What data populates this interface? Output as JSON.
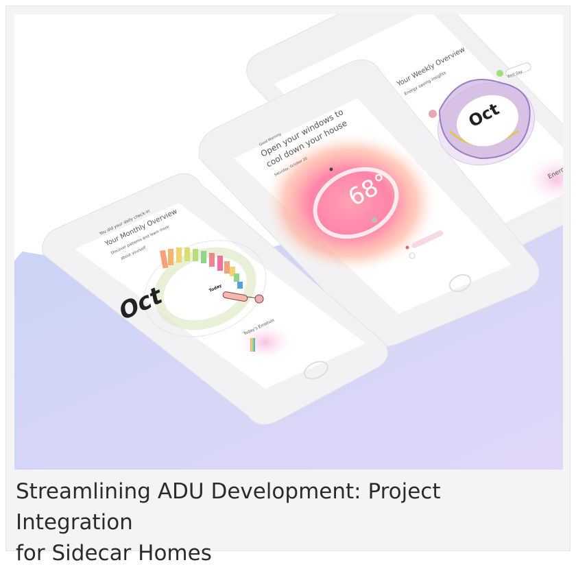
{
  "caption": {
    "line1": "Streamlining ADU Development: Project Integration",
    "line2": "for Sidecar Homes"
  },
  "phone_left": {
    "checkin": "You did your daily check-in",
    "title": "Your Monthly Overview",
    "subtitle1": "Discover patterns and learn more",
    "subtitle2": "about yourself",
    "month": "Oct",
    "today": "Today",
    "emotion_label": "Today's Emotion"
  },
  "phone_center": {
    "greeting": "Good Morning",
    "headline1": "Open your windows to",
    "headline2": "cool down your house",
    "date": "Saturday, October 20",
    "temperature": "68°"
  },
  "phone_right": {
    "title": "Your Weekly Overview",
    "subtitle": "Energy saving insights",
    "month": "Oct",
    "tag": "Best Day",
    "energy": "Energy Co"
  },
  "colors": {
    "card_bg": "#f4f4f4",
    "caption_text": "#2b2b2b",
    "hero_gradient_start": "#c7d3f7",
    "hero_gradient_end": "#e0d6f7",
    "accent_pink": "#f2709c",
    "accent_purple": "#9b7cc4"
  }
}
